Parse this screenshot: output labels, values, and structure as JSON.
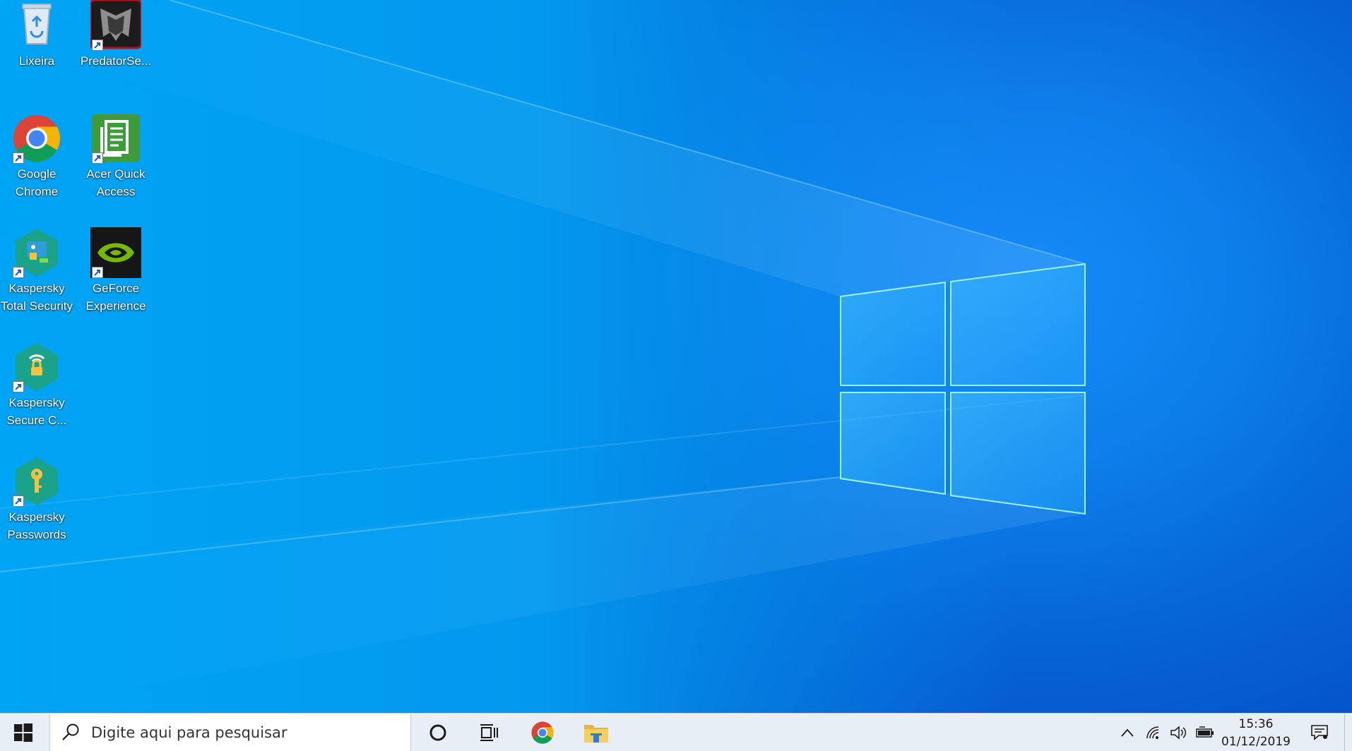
{
  "desktop": {
    "icons": [
      {
        "id": "recycle-bin",
        "label": "Lixeira"
      },
      {
        "id": "predator-sense",
        "label": "PredatorSe..."
      },
      {
        "id": "google-chrome",
        "label": "Google Chrome"
      },
      {
        "id": "acer-quick-access",
        "label": "Acer Quick Access"
      },
      {
        "id": "kaspersky-total-security",
        "label": "Kaspersky Total Security"
      },
      {
        "id": "geforce-experience",
        "label": "GeForce Experience"
      },
      {
        "id": "kaspersky-secure-connection",
        "label": "Kaspersky Secure C..."
      },
      {
        "id": "kaspersky-passwords",
        "label": "Kaspersky Passwords"
      }
    ]
  },
  "taskbar": {
    "search_placeholder": "Digite aqui para pesquisar",
    "pinned": [
      "cortana-icon",
      "task-view-icon",
      "chrome-icon",
      "file-explorer-icon"
    ],
    "tray_icons": [
      "chevron-up-icon",
      "wifi-icon",
      "volume-icon",
      "battery-icon"
    ],
    "clock": {
      "time": "15:36",
      "date": "01/12/2019"
    },
    "notification_icon": "action-center-icon"
  },
  "colors": {
    "wallpaper_base": "#0664d6",
    "wallpaper_light": "#00a4f4",
    "taskbar": "#e8eef5"
  }
}
